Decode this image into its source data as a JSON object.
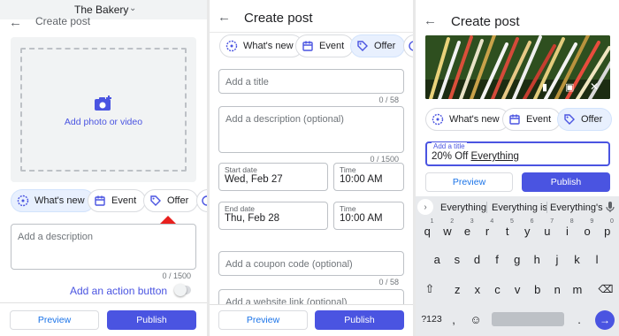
{
  "panel1": {
    "business_name": "The Bakery",
    "title": "Create post",
    "add_media_label": "Add photo or video",
    "chips": [
      {
        "label": "What's new",
        "icon": "whats-new-icon"
      },
      {
        "label": "Event",
        "icon": "calendar-icon"
      },
      {
        "label": "Offer",
        "icon": "tag-icon"
      }
    ],
    "description_placeholder": "Add a description",
    "description_counter": "0 / 1500",
    "action_button_label": "Add an action button",
    "preview_label": "Preview",
    "publish_label": "Publish"
  },
  "panel2": {
    "title": "Create post",
    "chips": [
      {
        "label": "What's new",
        "icon": "whats-new-icon"
      },
      {
        "label": "Event",
        "icon": "calendar-icon"
      },
      {
        "label": "Offer",
        "icon": "tag-icon"
      }
    ],
    "title_placeholder": "Add a title",
    "title_counter": "0 / 58",
    "description_placeholder": "Add a description (optional)",
    "description_counter": "0 / 1500",
    "start_date_label": "Start date",
    "start_date_value": "Wed, Feb 27",
    "start_time_label": "Time",
    "start_time_value": "10:00 AM",
    "end_date_label": "End date",
    "end_date_value": "Thu, Feb 28",
    "end_time_label": "Time",
    "end_time_value": "10:00 AM",
    "coupon_placeholder": "Add a coupon code (optional)",
    "coupon_counter": "0 / 58",
    "website_placeholder": "Add a website link (optional)",
    "preview_label": "Preview",
    "publish_label": "Publish"
  },
  "panel3": {
    "title": "Create post",
    "chips": [
      {
        "label": "What's new",
        "icon": "whats-new-icon"
      },
      {
        "label": "Event",
        "icon": "calendar-icon"
      },
      {
        "label": "Offer",
        "icon": "tag-icon"
      }
    ],
    "title_field_label": "Add a title",
    "title_prefix": "20% Off ",
    "title_underlined": "Everything",
    "preview_label": "Preview",
    "publish_label": "Publish",
    "suggestions": [
      "Everything",
      "Everything is",
      "Everything's"
    ],
    "keyboard": {
      "row1": [
        "q",
        "w",
        "e",
        "r",
        "t",
        "y",
        "u",
        "i",
        "o",
        "p"
      ],
      "row1_hints": [
        "1",
        "2",
        "3",
        "4",
        "5",
        "6",
        "7",
        "8",
        "9",
        "0"
      ],
      "row2": [
        "a",
        "s",
        "d",
        "f",
        "g",
        "h",
        "j",
        "k",
        "l"
      ],
      "row3": [
        "z",
        "x",
        "c",
        "v",
        "b",
        "n",
        "m"
      ],
      "symbols_label": "?123",
      "comma_label": ",",
      "period_label": "."
    }
  },
  "colors": {
    "accent": "#4a54e1",
    "link": "#1a73e8",
    "chip_selected": "#e8f0fe",
    "arrow_red": "#e8201e"
  }
}
